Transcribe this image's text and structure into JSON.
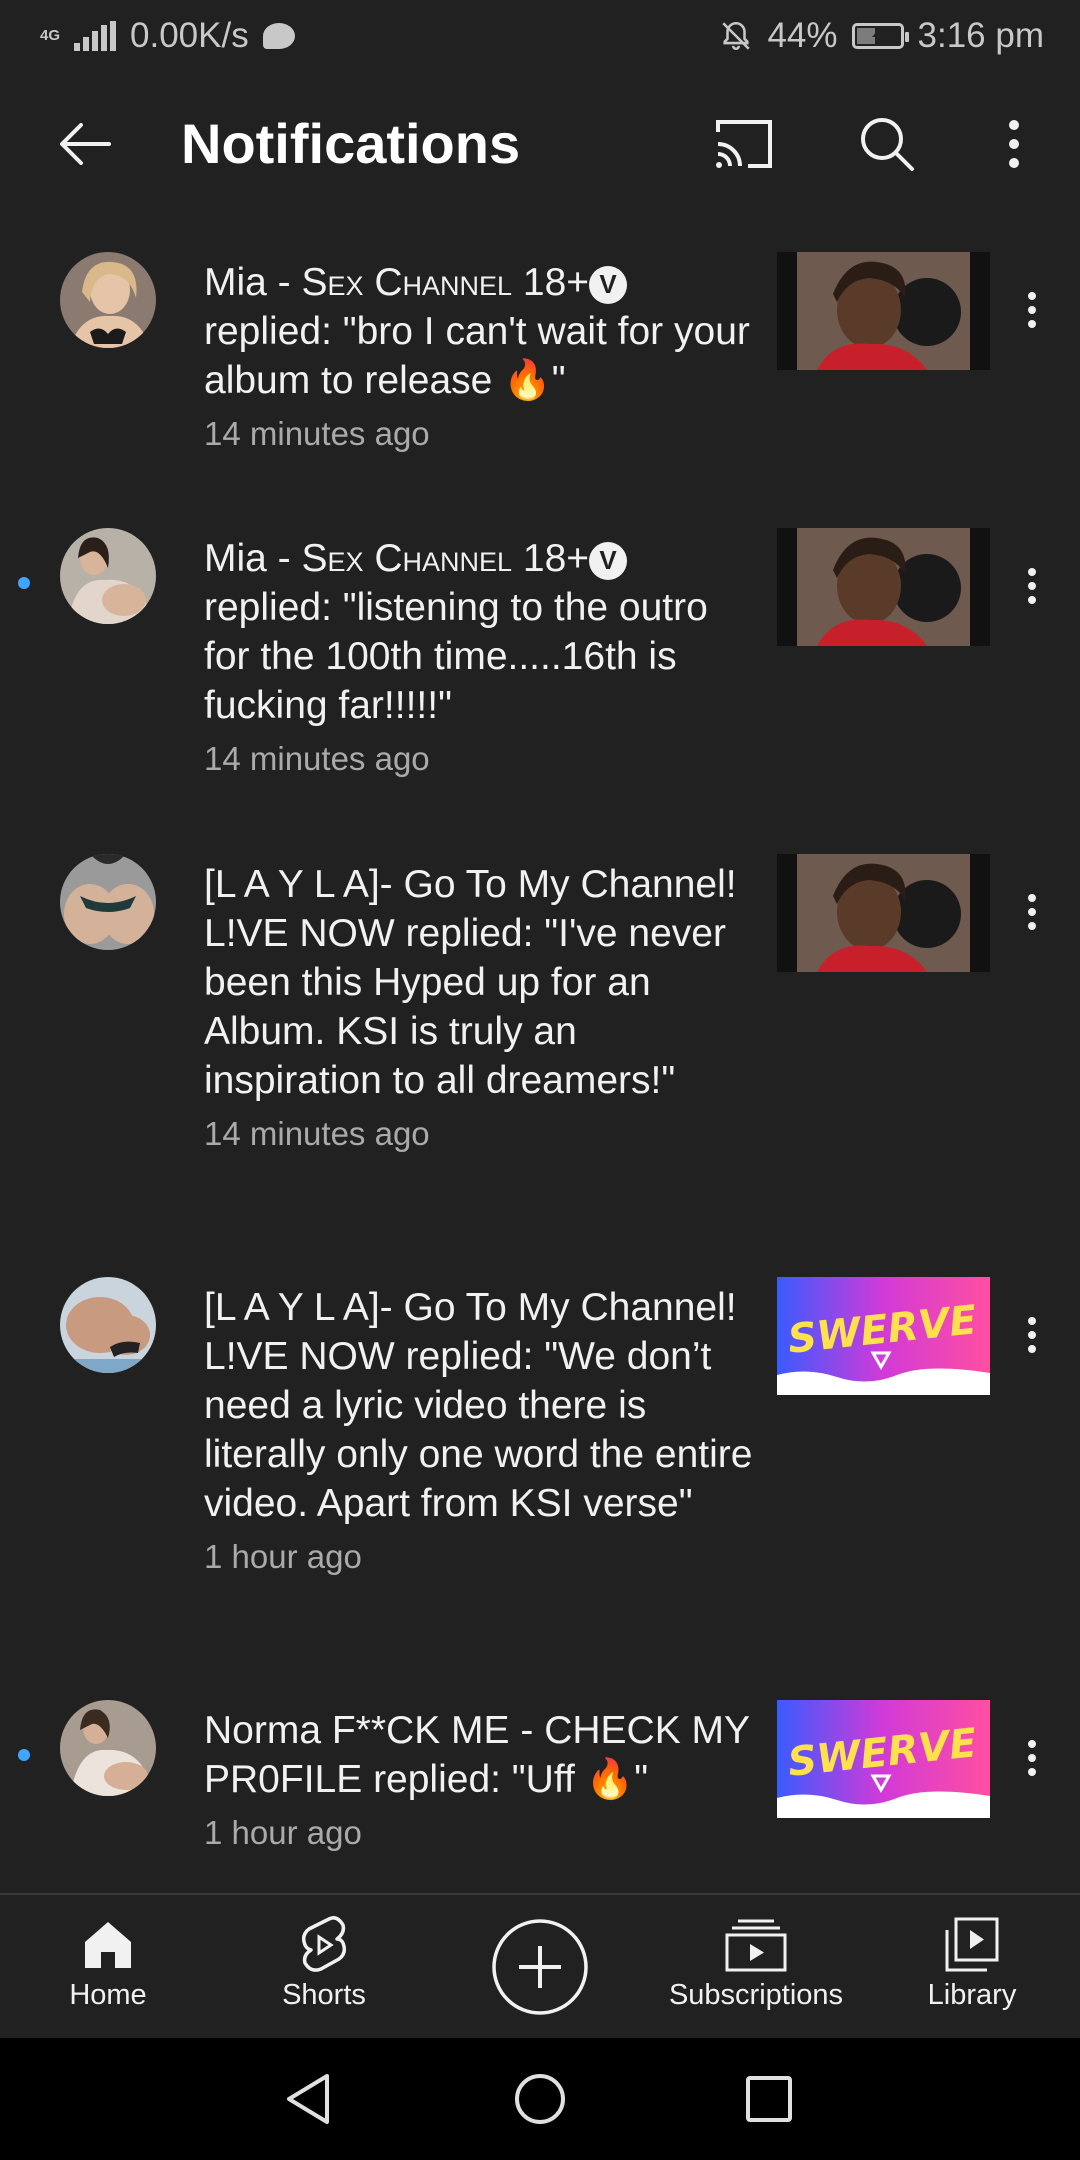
{
  "status_bar": {
    "network": "4G",
    "speed": "0.00K/s",
    "battery": "44%",
    "battery_fraction": 0.44,
    "time": "3:16 pm"
  },
  "header": {
    "title": "Notifications",
    "icons": [
      "back-arrow-icon",
      "cast-icon",
      "search-icon",
      "more-vert-icon"
    ]
  },
  "notifications": [
    {
      "author_prefix": "Mia - S",
      "author_sc": "ex Channel",
      "author_suffix": " 18+",
      "verified_mark": "V",
      "body": "replied: \"bro I can't wait for your album to release ",
      "emoji": "🔥",
      "body_end": "\"",
      "time": "14 minutes ago",
      "unread": false,
      "thumbnail": "studio-portrait"
    },
    {
      "author_prefix": "Mia - S",
      "author_sc": "ex Channel",
      "author_suffix": " 18+",
      "verified_mark": "V",
      "body": "replied: \"listening to the outro for the 100th time.....16th is fucking far!!!!!\"",
      "time": "14 minutes ago",
      "unread": true,
      "thumbnail": "studio-portrait"
    },
    {
      "text": "[L A Y L A]- Go To My Channel! L!VE NOW replied: \"I've never been this Hyped up for an Album. KSI is truly an inspiration to all dreamers!\"",
      "time": "14 minutes ago",
      "unread": false,
      "thumbnail": "studio-portrait"
    },
    {
      "text": "[L A Y L A]- Go To My Channel! L!VE NOW replied: \"We don’t need a lyric video there is literally only one word the entire video. Apart from KSI verse\"",
      "time": "1 hour ago",
      "unread": false,
      "thumbnail": "swerve-artwork",
      "thumbnail_text": "SWERVE"
    },
    {
      "text": "Norma F**CK ME - CHECK MY PR0FILE replied: \"Uff ",
      "emoji": "🔥",
      "text_end": "\"",
      "time": "1 hour ago",
      "unread": true,
      "thumbnail": "swerve-artwork",
      "thumbnail_text": "SWERVE"
    }
  ],
  "bottom_nav": [
    {
      "label": "Home",
      "icon": "home-icon",
      "active": true
    },
    {
      "label": "Shorts",
      "icon": "shorts-icon"
    },
    {
      "label": "",
      "icon": "create-icon"
    },
    {
      "label": "Subscriptions",
      "icon": "subscriptions-icon"
    },
    {
      "label": "Library",
      "icon": "library-icon"
    }
  ],
  "system_nav": [
    "back-triangle-icon",
    "home-circle-icon",
    "recents-square-icon"
  ],
  "colors": {
    "background": "#212121",
    "text": "#f1f1f1",
    "secondary_text": "#aaaaaa",
    "unread_dot": "#3ea6ff"
  }
}
